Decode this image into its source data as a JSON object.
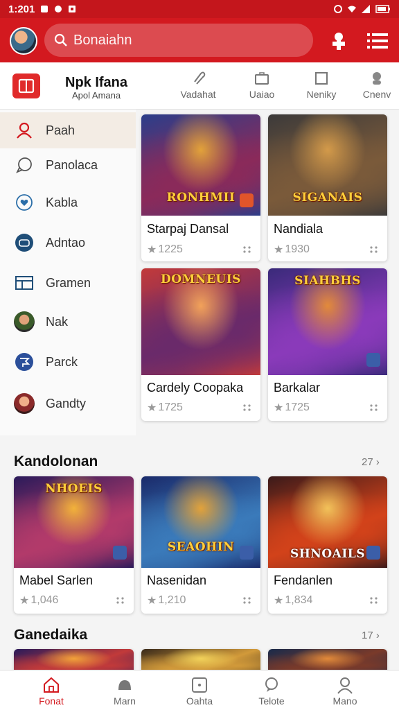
{
  "status_bar": {
    "time": "1:201"
  },
  "search": {
    "placeholder": "Bonaiahn"
  },
  "brand": {
    "title": "Npk Ifana",
    "subtitle": "Apol Amana"
  },
  "category_tabs": [
    {
      "label": "Vadahat",
      "icon": "paperclip-icon"
    },
    {
      "label": "Uaiao",
      "icon": "briefcase-icon"
    },
    {
      "label": "Neniky",
      "icon": "square-icon"
    },
    {
      "label": "Cnenv",
      "icon": "person-icon"
    }
  ],
  "sidebar": {
    "items": [
      {
        "label": "Paah",
        "icon": "user-icon",
        "active": true
      },
      {
        "label": "Panolaca",
        "icon": "chat-icon"
      },
      {
        "label": "Kabla",
        "icon": "heart-icon"
      },
      {
        "label": "Adntao",
        "icon": "gamepad-icon"
      },
      {
        "label": "Gramen",
        "icon": "window-icon"
      },
      {
        "label": "Nak",
        "icon": "avatar-icon"
      },
      {
        "label": "Parck",
        "icon": "flag-icon"
      },
      {
        "label": "Gandty",
        "icon": "avatar-icon"
      }
    ]
  },
  "featured": [
    {
      "name": "Starpaj Dansal",
      "rating": "1225",
      "art_title": "RONHMII",
      "palette": [
        "#2b3e8a",
        "#8a2a5a",
        "#e2a23a"
      ]
    },
    {
      "name": "Nandiala",
      "rating": "1930",
      "art_title": "SIGANAIS",
      "palette": [
        "#3c3a3a",
        "#7a5a3a",
        "#d39a4a"
      ]
    },
    {
      "name": "Cardely Coopaka",
      "rating": "1725",
      "art_title": "DOMNEUIS",
      "palette": [
        "#c23a3a",
        "#6a2a6a",
        "#f2a25a"
      ]
    },
    {
      "name": "Barkalar",
      "rating": "1725",
      "art_title": "SIAHBHS",
      "palette": [
        "#3a2a7a",
        "#8a3aba",
        "#e28a3a"
      ]
    }
  ],
  "sections": [
    {
      "title": "Kandolonan",
      "count": "27",
      "games": [
        {
          "name": "Mabel Sarlen",
          "rating": "1,046",
          "art_title": "NHOEIS",
          "palette": [
            "#2a1a5a",
            "#b23a6a",
            "#f2b23a"
          ]
        },
        {
          "name": "Nasenidan",
          "rating": "1,210",
          "art_title": "SEAOHIN",
          "palette": [
            "#1a2a6a",
            "#3a7aba",
            "#e2a23a"
          ]
        },
        {
          "name": "Fendanlen",
          "rating": "1,834",
          "art_title": "SHNOAILS",
          "palette": [
            "#3a1a1a",
            "#d2421a",
            "#f2c25a"
          ]
        }
      ]
    },
    {
      "title": "Ganedaika",
      "count": "17",
      "games": [
        {
          "name": "",
          "rating": "",
          "art_title": "",
          "palette": [
            "#2a1a5a",
            "#c23a3a",
            "#f2a23a"
          ]
        },
        {
          "name": "",
          "rating": "",
          "art_title": "",
          "palette": [
            "#3a2a1a",
            "#d29a3a",
            "#f2d25a"
          ]
        },
        {
          "name": "",
          "rating": "",
          "art_title": "",
          "palette": [
            "#1a2a4a",
            "#7a3a2a",
            "#e28a3a"
          ]
        }
      ]
    }
  ],
  "bottom_nav": [
    {
      "label": "Fonat",
      "icon": "home-icon",
      "active": true
    },
    {
      "label": "Marn",
      "icon": "controller-icon"
    },
    {
      "label": "Oahta",
      "icon": "calendar-icon"
    },
    {
      "label": "Telote",
      "icon": "chat-bubble-icon"
    },
    {
      "label": "Mano",
      "icon": "profile-icon"
    }
  ],
  "colors": {
    "brand_red": "#d3191f",
    "status_red": "#c4161c",
    "active_tint": "#f3ece4"
  }
}
